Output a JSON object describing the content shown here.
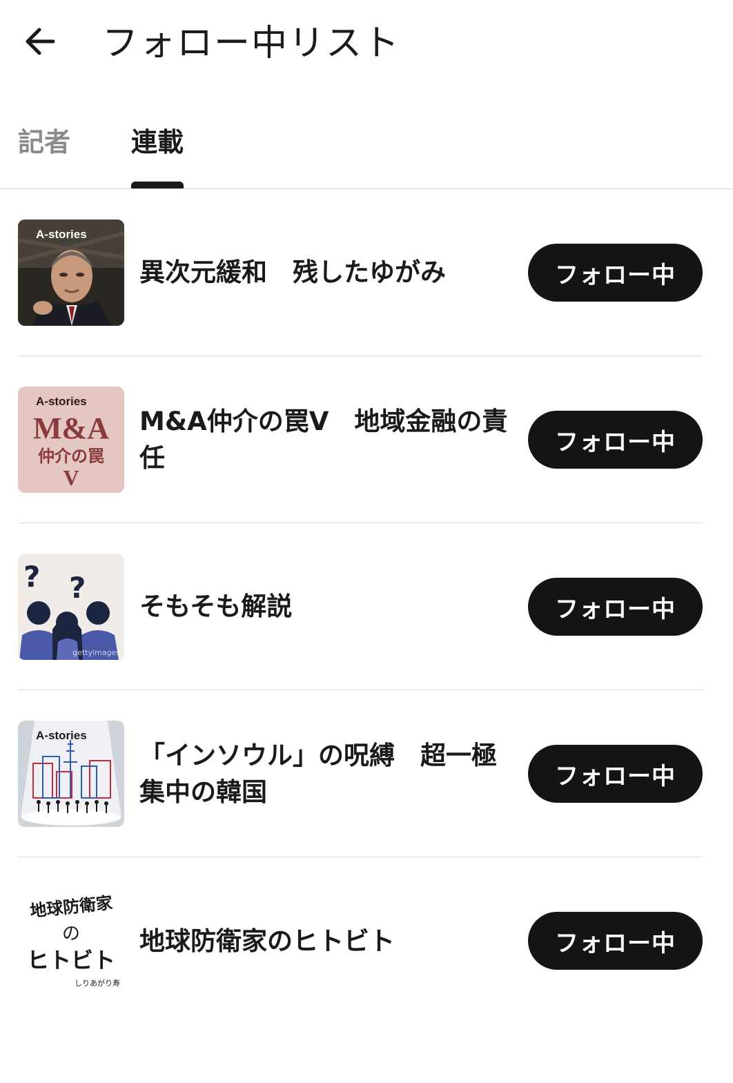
{
  "header": {
    "back_icon": "arrow-left-icon",
    "title": "フォロー中リスト"
  },
  "tabs": [
    {
      "label": "記者",
      "active": false
    },
    {
      "label": "連載",
      "active": true
    }
  ],
  "colors": {
    "button_bg": "#141414",
    "button_text": "#ffffff",
    "inactive_tab": "#8a8a8a",
    "divider": "#dcdcdc"
  },
  "series": [
    {
      "thumb_label": "A-stories",
      "thumb_icon": "portrait-photo",
      "title": "異次元緩和　残したゆがみ",
      "button": "フォロー中"
    },
    {
      "thumb_label": "A-stories",
      "thumb_lines": [
        "M&A",
        "仲介の罠",
        "V"
      ],
      "title": "M&A仲介の罠V　地域金融の責任",
      "button": "フォロー中"
    },
    {
      "thumb_icon": "question-people-illustration",
      "thumb_watermark": "gettyimages",
      "title": "そもそも解説",
      "button": "フォロー中"
    },
    {
      "thumb_label": "A-stories",
      "thumb_icon": "city-crowd-illustration",
      "title": "「インソウル」の呪縛　超一極集中の韓国",
      "button": "フォロー中"
    },
    {
      "thumb_icon": "handwritten-logo",
      "thumb_lines": [
        "地球防衛家",
        "の",
        "ヒトビト",
        "しりあがり寿"
      ],
      "title": "地球防衛家のヒトビト",
      "button": "フォロー中"
    }
  ]
}
